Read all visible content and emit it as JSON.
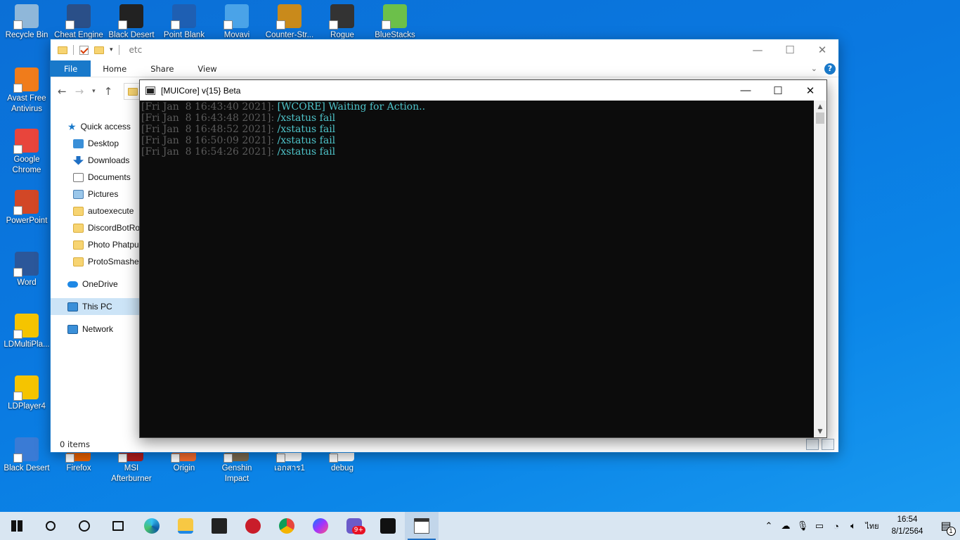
{
  "desktop": {
    "top_icons": [
      {
        "label": "Recycle Bin",
        "icon": "recycle-bin-icon",
        "color": "#8fb7d9"
      },
      {
        "label": "Cheat Engine",
        "icon": "cheat-engine-icon",
        "color": "#2a4f88"
      },
      {
        "label": "Black Desert",
        "icon": "black-desert-icon",
        "color": "#222222"
      },
      {
        "label": "Point Blank",
        "icon": "point-blank-icon",
        "color": "#1e5fb3"
      },
      {
        "label": "Movavi",
        "icon": "movavi-icon",
        "color": "#4aa3e8"
      },
      {
        "label": "Counter-Str...",
        "icon": "counter-strike-icon",
        "color": "#c98a1b"
      },
      {
        "label": "Rogue",
        "icon": "rogue-icon",
        "color": "#333333"
      },
      {
        "label": "BlueStacks",
        "icon": "bluestacks-icon",
        "color": "#6cc04a"
      }
    ],
    "left_icons": [
      {
        "label": "Avast Free Antivirus",
        "icon": "avast-icon",
        "color": "#f07c1b"
      },
      {
        "label": "Google Chrome",
        "icon": "chrome-icon",
        "color": "#e8453c"
      },
      {
        "label": "PowerPoint",
        "icon": "powerpoint-icon",
        "color": "#d24726"
      },
      {
        "label": "Word",
        "icon": "word-icon",
        "color": "#2b579a"
      },
      {
        "label": "LDMultiPla...",
        "icon": "ldmultiplayer-icon",
        "color": "#f5c400"
      },
      {
        "label": "LDPlayer4",
        "icon": "ldplayer-icon",
        "color": "#f5c400"
      },
      {
        "label": "Black Desert",
        "icon": "black-desert-2-icon",
        "color": "#3a7bd5"
      }
    ],
    "bottom_icons": [
      {
        "label": "Firefox",
        "icon": "firefox-icon",
        "color": "#e66000"
      },
      {
        "label": "MSI Afterburner",
        "icon": "msi-afterburner-icon",
        "color": "#b01e1e"
      },
      {
        "label": "Origin",
        "icon": "origin-icon",
        "color": "#f56c2d"
      },
      {
        "label": "Genshin Impact",
        "icon": "genshin-impact-icon",
        "color": "#7a6a4f"
      },
      {
        "label": "เอกสาร1",
        "icon": "document-icon",
        "color": "#ffffff"
      },
      {
        "label": "debug",
        "icon": "text-file-icon",
        "color": "#ffffff"
      }
    ]
  },
  "explorer": {
    "title": "etc",
    "ribbon_tabs": [
      "File",
      "Home",
      "Share",
      "View"
    ],
    "help": "?",
    "nav": {
      "quick_access": "Quick access",
      "quick_items": [
        "Desktop",
        "Downloads",
        "Documents",
        "Pictures",
        "autoexecute",
        "DiscordBotRobl",
        "Photo Phatput",
        "ProtoSmasher"
      ],
      "onedrive": "OneDrive",
      "this_pc": "This PC",
      "network": "Network"
    },
    "status": "0 items"
  },
  "console": {
    "title": "[MUICore] v{15} Beta",
    "lines": [
      {
        "stamp": "[Fri Jan  8 16:43:40 2021]: ",
        "msg": "[WCORE] Waiting for Action.."
      },
      {
        "stamp": "[Fri Jan  8 16:43:48 2021]: ",
        "msg": "/xstatus fail"
      },
      {
        "stamp": "[Fri Jan  8 16:48:52 2021]: ",
        "msg": "/xstatus fail"
      },
      {
        "stamp": "[Fri Jan  8 16:50:09 2021]: ",
        "msg": "/xstatus fail"
      },
      {
        "stamp": "[Fri Jan  8 16:54:26 2021]: ",
        "msg": "/xstatus fail"
      }
    ]
  },
  "taskbar": {
    "apps": [
      "start-icon",
      "search-icon",
      "cortana-icon",
      "task-view-icon",
      "edge-icon",
      "file-explorer-icon",
      "store-icon",
      "app-red-icon",
      "chrome-icon",
      "messenger-icon",
      "game-badge-icon",
      "garena-icon",
      "console-app-icon"
    ],
    "badge": "9+",
    "language": "ไทย",
    "time": "16:54",
    "date": "8/1/2564",
    "notifications": "1"
  },
  "colors": {
    "accent": "#1979ca",
    "console_text": "#4ec3c9",
    "console_stamp": "#5b5b5b"
  }
}
